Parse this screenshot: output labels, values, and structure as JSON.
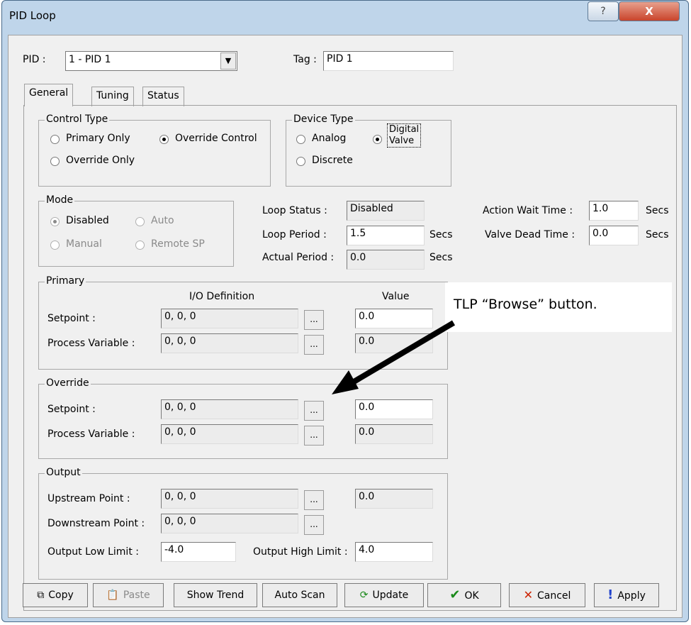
{
  "window": {
    "title": "PID Loop",
    "help_glyph": "?",
    "close_glyph": "X"
  },
  "header": {
    "pid_label": "PID :",
    "pid_value": "1 - PID 1",
    "tag_label": "Tag :",
    "tag_value": "PID 1"
  },
  "tabs": [
    "General",
    "Tuning",
    "Status"
  ],
  "control_type": {
    "legend": "Control Type",
    "primary_only": "Primary Only",
    "override_control": "Override Control",
    "override_only": "Override Only"
  },
  "device_type": {
    "legend": "Device Type",
    "analog": "Analog",
    "digital_valve_line1": "Digital",
    "digital_valve_line2": "Valve",
    "discrete": "Discrete"
  },
  "mode": {
    "legend": "Mode",
    "disabled": "Disabled",
    "auto": "Auto",
    "manual": "Manual",
    "remote_sp": "Remote SP"
  },
  "loop": {
    "status_label": "Loop Status :",
    "status_value": "Disabled",
    "period_label": "Loop Period :",
    "period_value": "1.5",
    "period_unit": "Secs",
    "actual_label": "Actual Period :",
    "actual_value": "0.0",
    "actual_unit": "Secs"
  },
  "timing": {
    "action_wait_label": "Action Wait Time :",
    "action_wait_value": "1.0",
    "action_wait_unit": "Secs",
    "valve_dead_label": "Valve Dead Time :",
    "valve_dead_value": "0.0",
    "valve_dead_unit": "Secs"
  },
  "primary": {
    "legend": "Primary",
    "io_header": "I/O Definition",
    "value_header": "Value",
    "setpoint_label": "Setpoint :",
    "setpoint_io": "0, 0, 0",
    "setpoint_value": "0.0",
    "pv_label": "Process Variable :",
    "pv_io": "0, 0, 0",
    "pv_value": "0.0"
  },
  "override": {
    "legend": "Override",
    "setpoint_label": "Setpoint :",
    "setpoint_io": "0, 0, 0",
    "setpoint_value": "0.0",
    "pv_label": "Process Variable :",
    "pv_io": "0, 0, 0",
    "pv_value": "0.0"
  },
  "output": {
    "legend": "Output",
    "upstream_label": "Upstream Point :",
    "upstream_io": "0, 0, 0",
    "upstream_value": "0.0",
    "downstream_label": "Downstream Point :",
    "downstream_io": "0, 0, 0",
    "low_label": "Output Low Limit :",
    "low_value": "-4.0",
    "high_label": "Output High Limit :",
    "high_value": "4.0"
  },
  "browse_glyph": "...",
  "callout": {
    "text": "TLP “Browse” button."
  },
  "buttons": {
    "copy": "Copy",
    "paste": "Paste",
    "show_trend": "Show Trend",
    "auto_scan": "Auto Scan",
    "update": "Update",
    "ok": "OK",
    "cancel": "Cancel",
    "apply": "Apply"
  },
  "colors": {
    "ok_check": "#1a8a1a",
    "cancel_x": "#cc2200",
    "apply_bang": "#2244cc",
    "close_btn": "#c9442b"
  }
}
